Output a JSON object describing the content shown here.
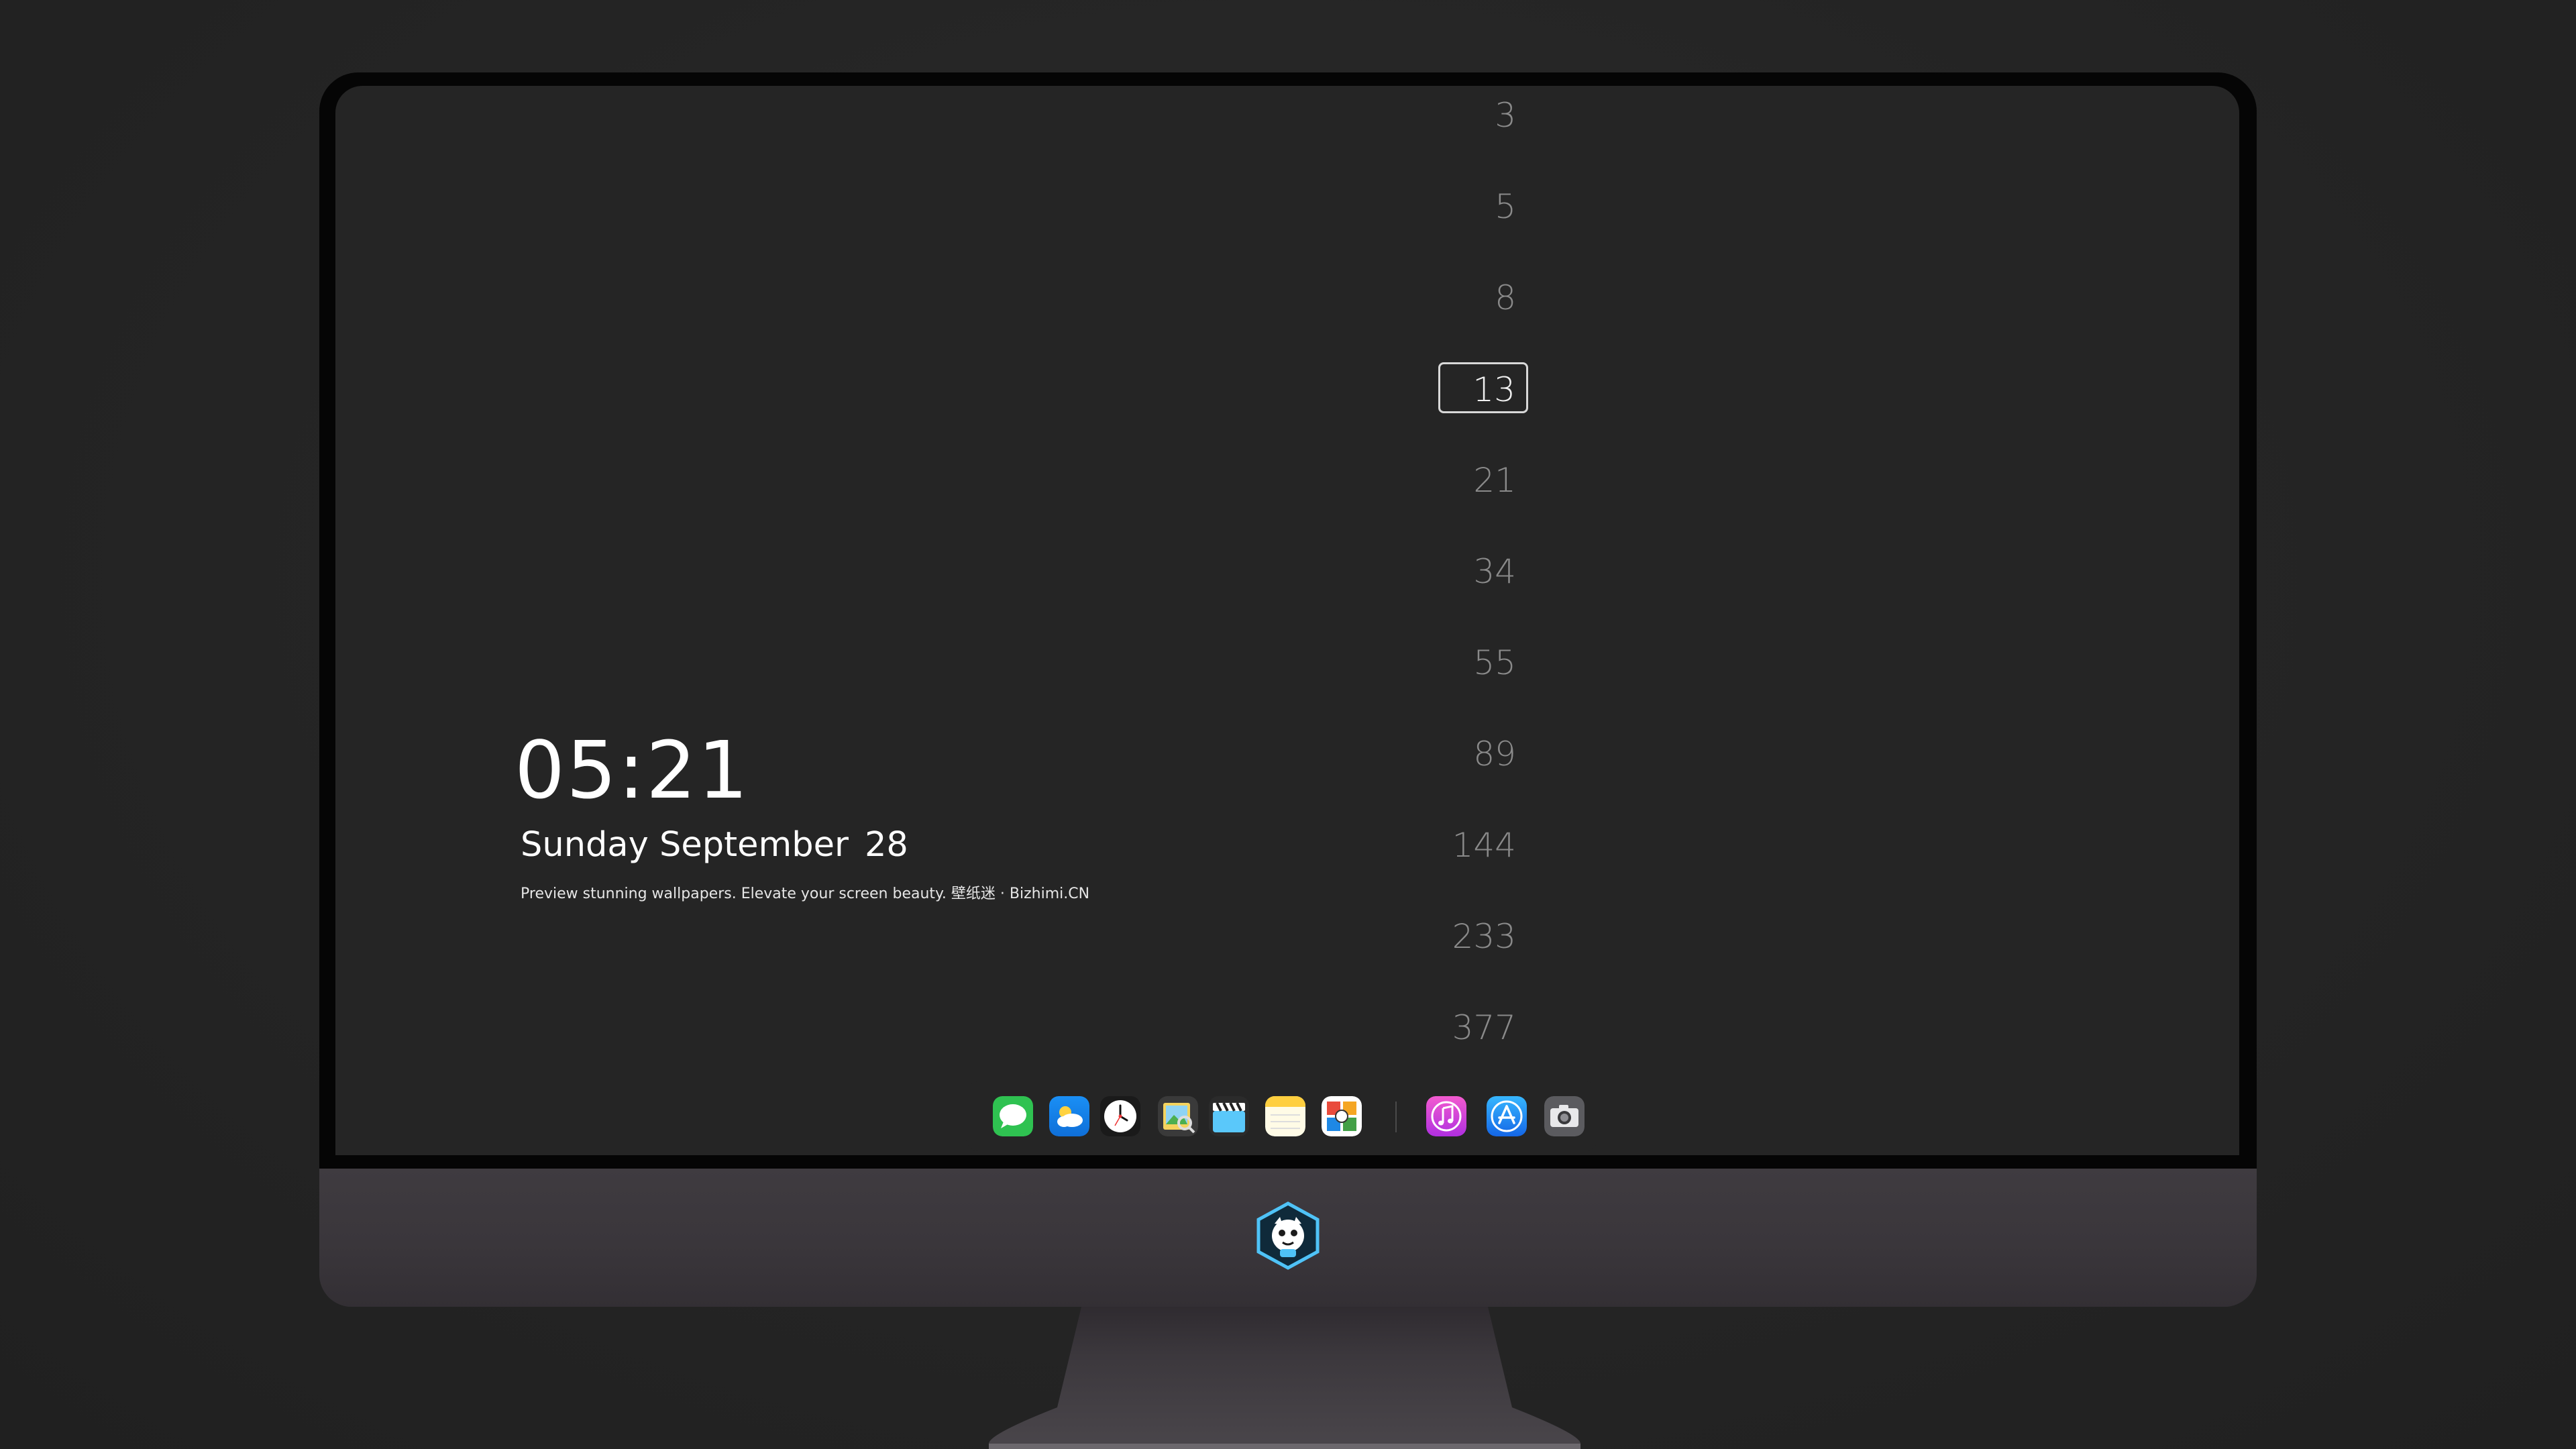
{
  "clock": {
    "time": "05:21",
    "weekday": "Sunday",
    "month": "September",
    "day": "28",
    "tagline": "Preview stunning wallpapers. Elevate your screen beauty. 壁纸迷 · Bizhimi.CN"
  },
  "number_picker": {
    "values": [
      "3",
      "5",
      "8",
      "13",
      "21",
      "34",
      "55",
      "89",
      "144",
      "233",
      "377"
    ],
    "selected": "13"
  },
  "dock": {
    "apps": [
      {
        "name": "Messages",
        "icon": "messages-icon",
        "color": "#34c759"
      },
      {
        "name": "Weather",
        "icon": "weather-icon",
        "color": "#1e8cf0"
      },
      {
        "name": "Clock",
        "icon": "clock-icon",
        "color": "#ffffff"
      },
      {
        "name": "Preview",
        "icon": "preview-icon",
        "color": "#f5c542"
      },
      {
        "name": "Clips",
        "icon": "clips-icon",
        "color": "#5ac8fa"
      },
      {
        "name": "Notes",
        "icon": "notes-icon",
        "color": "#ffd60a"
      },
      {
        "name": "Photo Booth",
        "icon": "photo-booth-icon",
        "color": "#34c759"
      },
      {
        "name": "iTunes",
        "icon": "itunes-icon",
        "color": "#d23de6"
      },
      {
        "name": "App Store",
        "icon": "app-store-icon",
        "color": "#1c8cf7"
      },
      {
        "name": "Screenshot",
        "icon": "camera-icon",
        "color": "#8e8e93"
      }
    ]
  },
  "colors": {
    "screen_background": "#252525",
    "bezel": "#050505",
    "chin": "#3d393e",
    "number_inactive": "#8a8a8a",
    "number_selected": "#f0f0f0"
  }
}
